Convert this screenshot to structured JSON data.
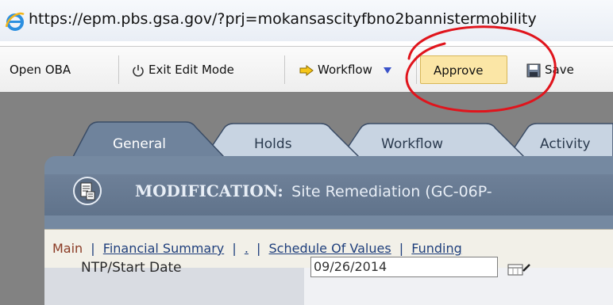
{
  "browser": {
    "url": "https://epm.pbs.gsa.gov/?prj=mokansascityfbno2bannistermobility",
    "icon": "ie-logo-icon"
  },
  "toolbar": {
    "open_oba": "Open OBA",
    "exit_edit_mode": "Exit Edit Mode",
    "workflow": "Workflow",
    "approve": "Approve",
    "save": "Save"
  },
  "tabs": [
    {
      "label": "General",
      "active": true
    },
    {
      "label": "Holds"
    },
    {
      "label": "Workflow"
    },
    {
      "label": "Activity"
    }
  ],
  "header": {
    "title_keyword": "MODIFICATION:",
    "title_text": "Site Remediation (GC-06P-"
  },
  "nav": {
    "main": "Main",
    "financial_summary": "Financial Summary",
    "dot": ".",
    "schedule_of_values": "Schedule Of Values",
    "funding": "Funding"
  },
  "form": {
    "field_label": "NTP/Start Date",
    "field_value": "09/26/2014"
  },
  "colors": {
    "approve_bg": "#fbe6a6",
    "annotation": "#e0141c",
    "panel": "#7589a1"
  }
}
